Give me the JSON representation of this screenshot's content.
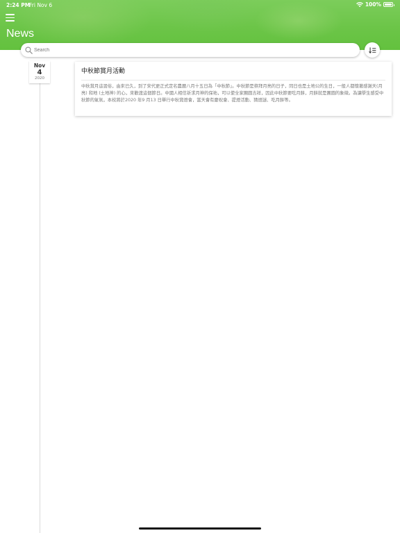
{
  "status_bar": {
    "time": "2:24 PM",
    "date": "Fri Nov 6",
    "battery": "100%"
  },
  "header": {
    "title": "News",
    "accent_color": "#6cc548"
  },
  "search": {
    "placeholder": "Search",
    "value": ""
  },
  "news": [
    {
      "month": "Nov",
      "day": "4",
      "year": "2020",
      "title": "中秋節賞月活動",
      "body": "中秋賞月這習俗，由來已久，到了宋代更正式定名農曆八月十五日為「中秋節」。中秋節是祭拜月亮的日子，同日也是土地公的生日，一般人都懷著感謝天(月亮) 和地 (土地神) 的心，來歡渡這個節日。中國人相信祈求月神的保祐，可以使全家團圓吉祥，因此中秋節要吃月餅，月餅就是團圓的象徵。為讓學生感受中秋節的氣氛，本校將於2020 年9 月13 日舉行中秋賞燈會，當天會有慶祝會、提燈活動、猜燈謎、吃月餅等。"
    }
  ]
}
